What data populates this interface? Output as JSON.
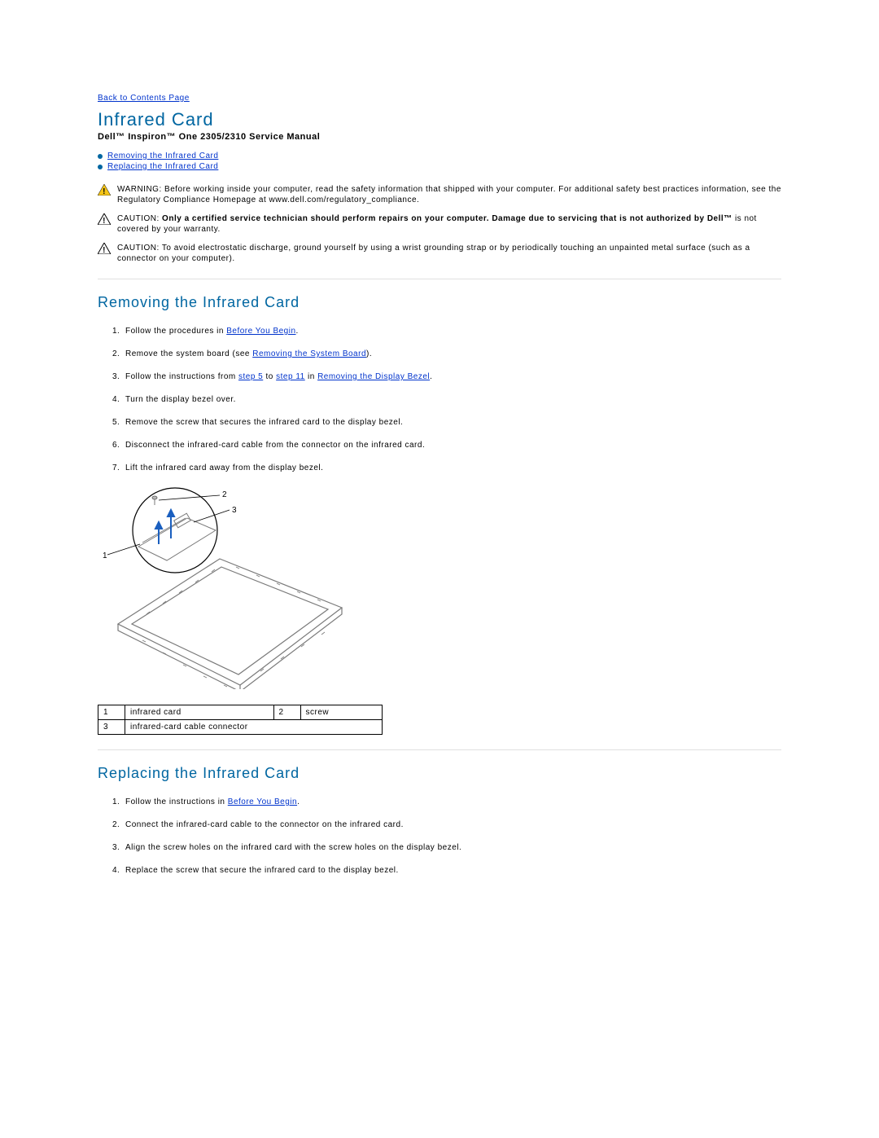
{
  "nav": {
    "back": "Back to Contents Page"
  },
  "page": {
    "title": "Infrared Card",
    "subtitle": "Dell™ Inspiron™ One 2305/2310 Service Manual"
  },
  "toc": {
    "item1": "Removing the Infrared Card",
    "item2": "Replacing the Infrared Card"
  },
  "alerts": {
    "warn_label": "WARNING:",
    "warn_text": " Before working inside your computer, read the safety information that shipped with your computer. For additional safety best practices information, see the Regulatory Compliance Homepage at www.dell.com/regulatory_compliance.",
    "caution1_label": "CAUTION:",
    "caution1_text_bold": " Only a certified service technician should perform repairs on your computer. Damage due to servicing that is not authorized by Dell™ ",
    "caution1_text_plain": "is not covered by your warranty.",
    "caution2_label": "CAUTION:",
    "caution2_text": " To avoid electrostatic discharge, ground yourself by using a wrist grounding strap or by periodically touching an unpainted metal surface (such as a connector on your computer)."
  },
  "removing": {
    "heading": "Removing the Infrared Card",
    "s1a": "Follow the procedures in ",
    "s1b": "Before You Begin",
    "s1c": ".",
    "s2a": "Remove the system board (see ",
    "s2b": "Removing the System Board",
    "s2c": ").",
    "s3a": "Follow the instructions from ",
    "s3b": "step 5",
    "s3c": " to ",
    "s3d": "step 11",
    "s3e": " in ",
    "s3f": "Removing the Display Bezel",
    "s3g": ".",
    "s4": "Turn the display bezel over.",
    "s5": "Remove the screw that secures the infrared card to the display bezel.",
    "s6": "Disconnect the infrared-card cable from the connector on the infrared card.",
    "s7": "Lift the infrared card away from the display bezel."
  },
  "callouts": {
    "c1": "1",
    "c2": "2",
    "c3": "3"
  },
  "parts": {
    "r1c1": "1",
    "r1c2": "infrared card",
    "r1c3": "2",
    "r1c4": "screw",
    "r2c1": "3",
    "r2c2": "infrared-card cable connector"
  },
  "replacing": {
    "heading": "Replacing the Infrared Card",
    "s1a": "Follow the instructions in ",
    "s1b": "Before You Begin",
    "s1c": ".",
    "s2": "Connect the infrared-card cable to the connector on the infrared card.",
    "s3": "Align the screw holes on the infrared card with the screw holes on the display bezel.",
    "s4": "Replace the screw that secure the infrared card to the display bezel."
  }
}
